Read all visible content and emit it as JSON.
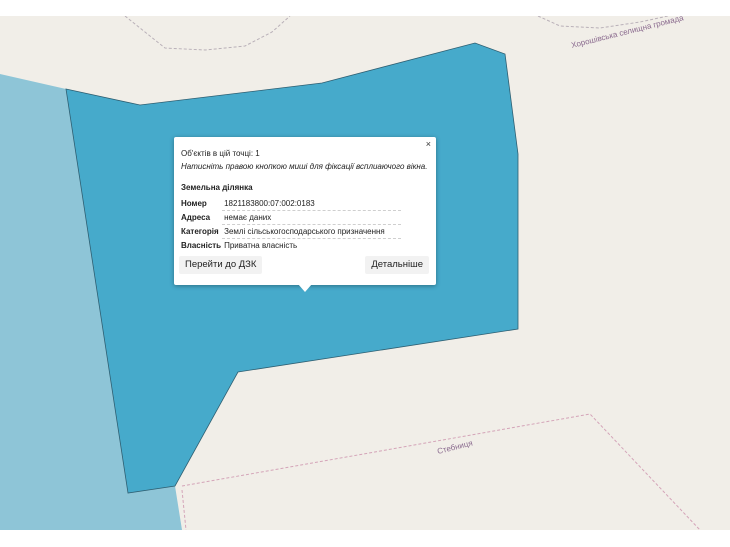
{
  "map": {
    "colors": {
      "background": "#f1eee8",
      "parcel_fill": "#46aacb",
      "neighbor_fill": "#8ec5d7",
      "boundary_gray": "#b9b0b8",
      "boundary_pink": "#d4a4b8"
    },
    "labels": {
      "community_top": "Хорошівська селищна громада",
      "community_bottom": "Стебниця"
    }
  },
  "popup": {
    "close_icon": "×",
    "objects_count_text": "Об'єктів в цій точці: 1",
    "hint_text": "Натисніть правою кнопкою миші для фіксації всплиаючого вікна.",
    "section_title": "Земельна ділянка",
    "rows": [
      {
        "key": "Номер",
        "value": "1821183800:07:002:0183"
      },
      {
        "key": "Адреса",
        "value": "немає даних"
      },
      {
        "key": "Категорія",
        "value": "Землі сільськогосподарського призначення"
      },
      {
        "key": "Власність",
        "value": "Приватна власність"
      }
    ],
    "buttons": {
      "dzk": "Перейти до ДЗК",
      "details": "Детальніше"
    }
  }
}
